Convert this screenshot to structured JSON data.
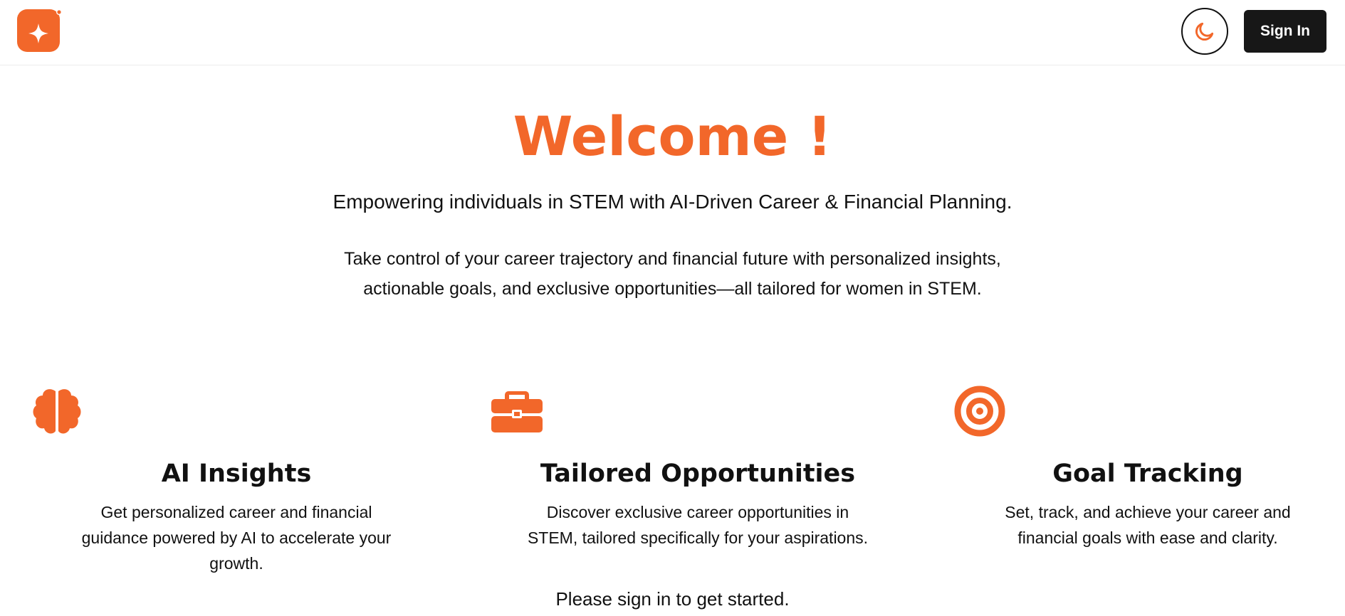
{
  "header": {
    "logo_icon": "sparkle-logo-icon",
    "theme_toggle_icon": "moon-icon",
    "sign_in_label": "Sign In"
  },
  "hero": {
    "title": "Welcome !",
    "tagline": "Empowering individuals in STEM with AI-Driven Career & Financial Planning.",
    "description": "Take control of your career trajectory and financial future with personalized insights, actionable goals, and exclusive opportunities—all tailored for women in STEM."
  },
  "features": [
    {
      "icon": "brain-icon",
      "title": "AI Insights",
      "description": "Get personalized career and financial guidance powered by AI to accelerate your growth."
    },
    {
      "icon": "briefcase-icon",
      "title": "Tailored Opportunities",
      "description": "Discover exclusive career opportunities in STEM, tailored specifically for your aspirations."
    },
    {
      "icon": "target-icon",
      "title": "Goal Tracking",
      "description": "Set, track, and achieve your career and financial goals with ease and clarity."
    }
  ],
  "cta": {
    "text": "Please sign in to get started."
  },
  "colors": {
    "accent": "#f2672a",
    "button_bg": "#171717",
    "text": "#111111"
  }
}
